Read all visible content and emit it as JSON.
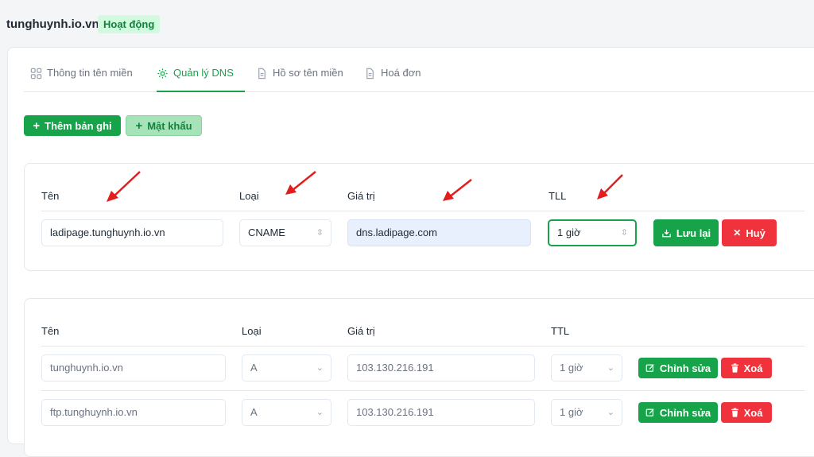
{
  "header": {
    "domain": "tunghuynh.io.vn",
    "status": "Hoạt động"
  },
  "tabs": [
    {
      "label": "Thông tin tên miền",
      "icon": "grid-icon"
    },
    {
      "label": "Quản lý DNS",
      "icon": "gear-icon"
    },
    {
      "label": "Hồ sơ tên miền",
      "icon": "document-icon"
    },
    {
      "label": "Hoá đơn",
      "icon": "document-icon"
    }
  ],
  "actions": {
    "add_record": "Thêm bản ghi",
    "password": "Mật khẩu"
  },
  "edit_form": {
    "labels": {
      "name": "Tên",
      "type": "Loại",
      "value": "Giá trị",
      "ttl": "TLL"
    },
    "name": "ladipage.tunghuynh.io.vn",
    "type": "CNAME",
    "value": "dns.ladipage.com",
    "ttl": "1 giờ",
    "save": "Lưu lại",
    "cancel": "Huỷ"
  },
  "records": {
    "headers": {
      "name": "Tên",
      "type": "Loại",
      "value": "Giá trị",
      "ttl": "TTL"
    },
    "rows": [
      {
        "name": "tunghuynh.io.vn",
        "type": "A",
        "value": "103.130.216.191",
        "ttl": "1 giờ"
      },
      {
        "name": "ftp.tunghuynh.io.vn",
        "type": "A",
        "value": "103.130.216.191",
        "ttl": "1 giờ"
      }
    ],
    "edit_label": "Chỉnh sửa",
    "delete_label": "Xoá"
  },
  "colors": {
    "accent": "#16a34a",
    "danger": "#f0323c",
    "annotation": "#e11d1d"
  }
}
